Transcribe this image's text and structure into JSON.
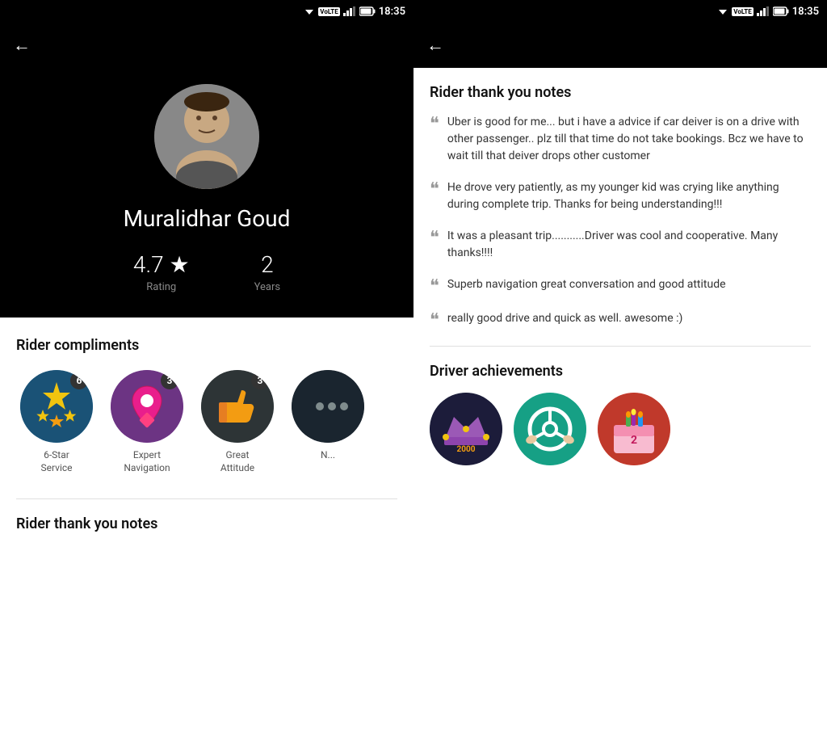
{
  "left": {
    "status_bar": {
      "time": "18:35",
      "volte": "VoLTE"
    },
    "back_label": "←",
    "driver": {
      "name": "Muralidhar Goud",
      "rating_value": "4.7 ★",
      "rating_label": "Rating",
      "years_value": "2",
      "years_label": "Years"
    },
    "compliments_title": "Rider compliments",
    "compliments": [
      {
        "label": "6-Star\nService",
        "count": "6"
      },
      {
        "label": "Expert\nNavigation",
        "count": "3"
      },
      {
        "label": "Great\nAttitude",
        "count": "3"
      },
      {
        "label": "N...",
        "count": ""
      }
    ],
    "notes_title": "Rider thank you notes"
  },
  "right": {
    "status_bar": {
      "time": "18:35",
      "volte": "VoLTE"
    },
    "back_label": "←",
    "notes_title": "Rider thank you notes",
    "notes": [
      "Uber is good for me... but i have a advice if car deiver is on a drive with other passenger.. plz till that time do not take bookings. Bcz we have to wait till that deiver drops other customer",
      "He drove very patiently,  as my younger kid was crying like anything during complete trip.  Thanks for being understanding!!!",
      "It was a pleasant trip...........Driver was cool and cooperative.  Many thanks!!!!",
      "Superb navigation great conversation and good attitude",
      "really good drive and quick as well.  awesome :)"
    ],
    "achievements_title": "Driver achievements"
  }
}
